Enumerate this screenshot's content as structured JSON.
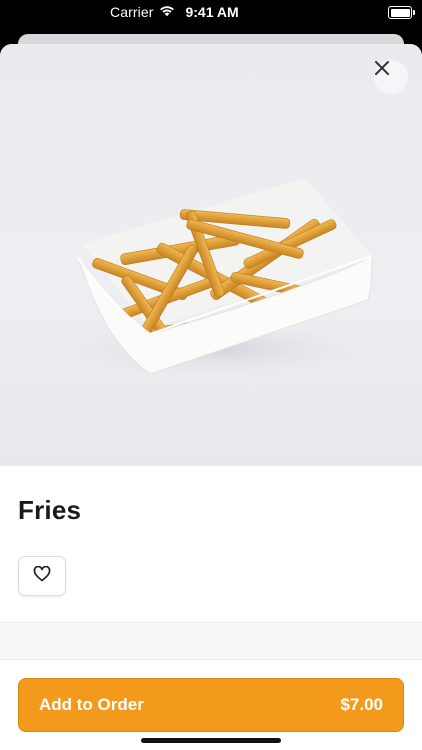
{
  "status_bar": {
    "carrier": "Carrier",
    "time": "9:41 AM"
  },
  "item": {
    "title": "Fries",
    "image_icon": "fries-photo"
  },
  "close_icon": "close-icon",
  "favorite_icon": "heart-icon",
  "cta": {
    "label": "Add to Order",
    "price": "$7.00"
  },
  "colors": {
    "accent": "#f39a1c",
    "accent_border": "#d98612",
    "title": "#1a1a1a"
  }
}
